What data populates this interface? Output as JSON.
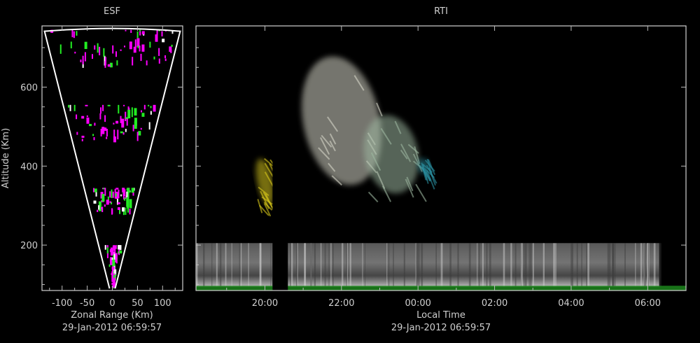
{
  "esf": {
    "title": "ESF",
    "xlabel": "Zonal Range (Km)",
    "ylabel": "Altitude (Km)",
    "timestamp": "29-Jan-2012 06:59:57"
  },
  "rti": {
    "title": "RTI",
    "xlabel": "Local Time",
    "timestamp": "29-Jan-2012 06:59:57"
  },
  "chart_data": [
    {
      "type": "heatmap",
      "title": "ESF",
      "xlabel": "Zonal Range (Km)",
      "ylabel": "Altitude (Km)",
      "xlim": [
        -140,
        140
      ],
      "ylim": [
        85,
        755
      ],
      "xticks": [
        -100,
        -50,
        0,
        50,
        100
      ],
      "xtick_labels": [
        "-100",
        "-50",
        "0",
        "50",
        "100"
      ],
      "yticks": [
        200,
        400,
        600
      ],
      "ytick_labels": [
        "200",
        "400",
        "600"
      ],
      "fan_apex_altitude": 90,
      "fan_top_altitude": 745,
      "fan_half_width_top": 135,
      "echo_bands": [
        {
          "alt_min": 90,
          "alt_max": 200,
          "color": "#ff00ff"
        },
        {
          "alt_min": 275,
          "alt_max": 345,
          "color": "#ff00ff"
        },
        {
          "alt_min": 460,
          "alt_max": 555,
          "color": "#ff00ff"
        },
        {
          "alt_min": 645,
          "alt_max": 745,
          "color": "#ff00ff"
        }
      ],
      "colors": {
        "echo_primary": "#ff00ff",
        "echo_secondary": "#22ee22",
        "echo_white": "#ffffff"
      }
    },
    {
      "type": "heatmap",
      "title": "RTI",
      "xlabel": "Local Time",
      "ylabel": "Altitude (Km)",
      "xlim": [
        18.2,
        31.0
      ],
      "ylim": [
        85,
        755
      ],
      "xticks": [
        20,
        22,
        24,
        26,
        28,
        30
      ],
      "xtick_labels": [
        "20:00",
        "22:00",
        "00:00",
        "02:00",
        "04:00",
        "06:00"
      ],
      "yticks": [
        200,
        400,
        600
      ],
      "features": [
        {
          "kind": "e_region_layer",
          "t_start": 18.2,
          "t_end": 30.3,
          "alt_min": 95,
          "alt_max": 205,
          "color": "#b8b8b8"
        },
        {
          "kind": "bottom_trace",
          "t_start": 18.2,
          "t_end": 31.0,
          "alt_min": 85,
          "alt_max": 97,
          "color": "#1e8f1e"
        },
        {
          "kind": "plume",
          "t_start": 21.0,
          "t_end": 23.0,
          "alt_min": 350,
          "alt_max": 680,
          "color": "#d6d6c8"
        },
        {
          "kind": "plume",
          "t_start": 22.6,
          "t_end": 24.0,
          "alt_min": 330,
          "alt_max": 530,
          "color": "#9db7a0"
        },
        {
          "kind": "plume",
          "t_start": 19.8,
          "t_end": 20.2,
          "alt_min": 300,
          "alt_max": 420,
          "color": "#d8c81a"
        },
        {
          "kind": "plume",
          "t_start": 24.0,
          "t_end": 24.3,
          "alt_min": 380,
          "alt_max": 420,
          "color": "#2a8fa0"
        },
        {
          "kind": "data_gap",
          "t_start": 20.2,
          "t_end": 20.6,
          "alt_min": 85,
          "alt_max": 755,
          "color": "#000000"
        }
      ],
      "colors": {
        "frame": "#d0d0d0"
      }
    }
  ]
}
